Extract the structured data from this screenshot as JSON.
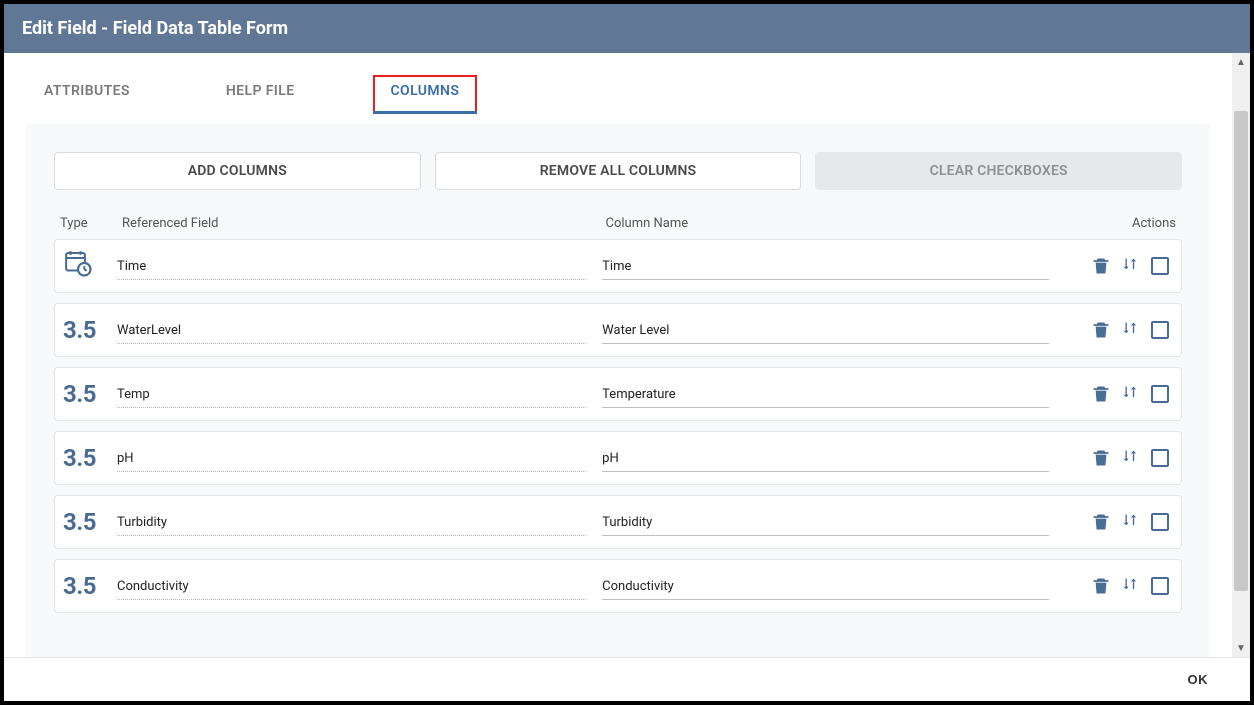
{
  "header": {
    "title": "Edit Field - Field Data Table Form"
  },
  "tabs": [
    {
      "label": "ATTRIBUTES",
      "active": false
    },
    {
      "label": "HELP FILE",
      "active": false
    },
    {
      "label": "COLUMNS",
      "active": true
    }
  ],
  "buttons": {
    "add": "ADD COLUMNS",
    "remove_all": "REMOVE ALL COLUMNS",
    "clear": "CLEAR CHECKBOXES"
  },
  "table": {
    "headers": {
      "type": "Type",
      "ref": "Referenced Field",
      "name": "Column Name",
      "actions": "Actions"
    },
    "rows": [
      {
        "type": "date",
        "ref": "Time",
        "name": "Time"
      },
      {
        "type": "number",
        "ref": "WaterLevel",
        "name": "Water Level"
      },
      {
        "type": "number",
        "ref": "Temp",
        "name": "Temperature"
      },
      {
        "type": "number",
        "ref": "pH",
        "name": "pH"
      },
      {
        "type": "number",
        "ref": "Turbidity",
        "name": "Turbidity"
      },
      {
        "type": "number",
        "ref": "Conductivity",
        "name": "Conductivity"
      }
    ],
    "number_type_badge": "3.5"
  },
  "footer": {
    "ok": "OK"
  }
}
